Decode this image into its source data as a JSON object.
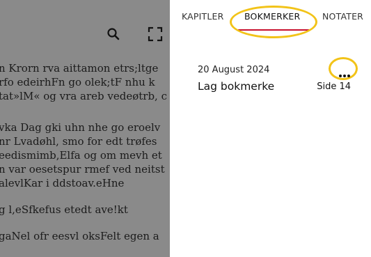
{
  "reader": {
    "lines": [
      "n Krorn rva aittamon etrs;ltge",
      "rfo edeirhFn go olek;tF nhu k",
      "tat»lM« og vra areb vedeøtrb, c",
      "",
      "vka Dag gki uhn nhe go eroelv",
      "nr Lvadøhl, smo for edt trøfes",
      "eedismimb,Elfa og om mevh et",
      "n var oesetspur rmef ved neitst",
      "alevlKar i ddstoav.eHne",
      "",
      "g l,eSfkefus etedt ave!kt",
      "",
      "gaNel ofr eesvl oksFelt egen a"
    ]
  },
  "panel": {
    "tabs": [
      {
        "label": "KAPITLER"
      },
      {
        "label": "BOKMERKER"
      },
      {
        "label": "NOTATER"
      }
    ],
    "active_tab": "BOKMERKER",
    "bookmark": {
      "date": "20 August 2024",
      "title": "Lag bokmerke",
      "page": "Side 14"
    }
  },
  "colors": {
    "active_underline": "#c8102e",
    "highlight": "#f2c318",
    "scrim": "rgba(0,0,0,0.46)"
  }
}
